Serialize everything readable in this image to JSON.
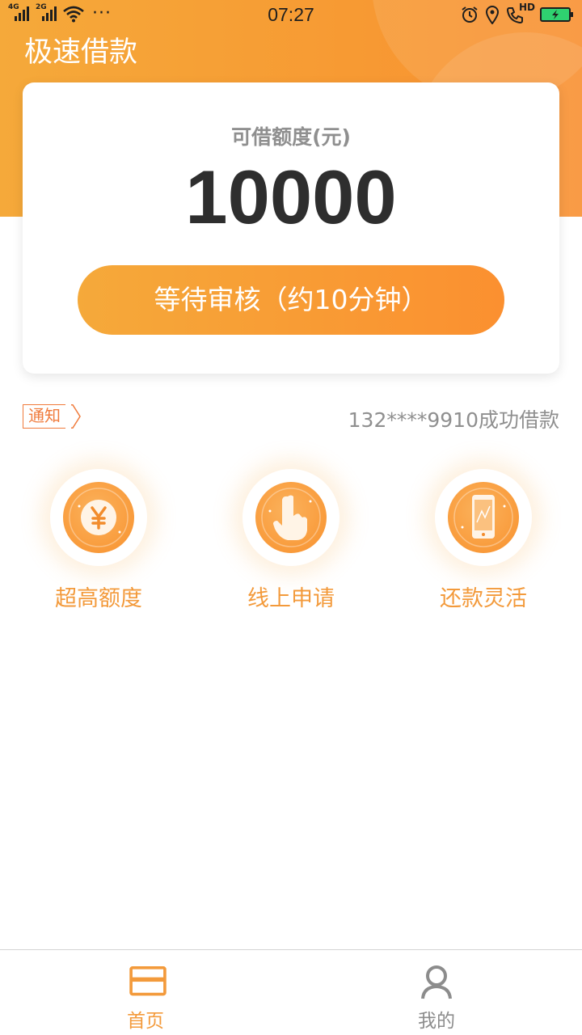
{
  "status_bar": {
    "sim1_tag": "4G",
    "sim2_tag": "2G",
    "more": "···",
    "time": "07:27",
    "hd": "HD"
  },
  "app": {
    "title": "极速借款"
  },
  "quota_card": {
    "label": "可借额度(元)",
    "amount": "10000",
    "button_label": "等待审核（约10分钟）"
  },
  "notice": {
    "tag": "通知",
    "text": "132****9910成功借款"
  },
  "features": [
    {
      "label": "超高额度",
      "icon": "yen-coin-icon"
    },
    {
      "label": "线上申请",
      "icon": "tap-hand-icon"
    },
    {
      "label": "还款灵活",
      "icon": "phone-icon"
    }
  ],
  "tabbar": {
    "items": [
      {
        "label": "首页",
        "icon": "home-card-icon",
        "active": true
      },
      {
        "label": "我的",
        "icon": "person-icon",
        "active": false
      }
    ]
  },
  "colors": {
    "accent": "#f89a32",
    "accent_text": "#f39a3b",
    "notice_orange": "#f07b3c",
    "tab_active": "#f39a3b",
    "tab_inactive": "#8c8c8c"
  }
}
